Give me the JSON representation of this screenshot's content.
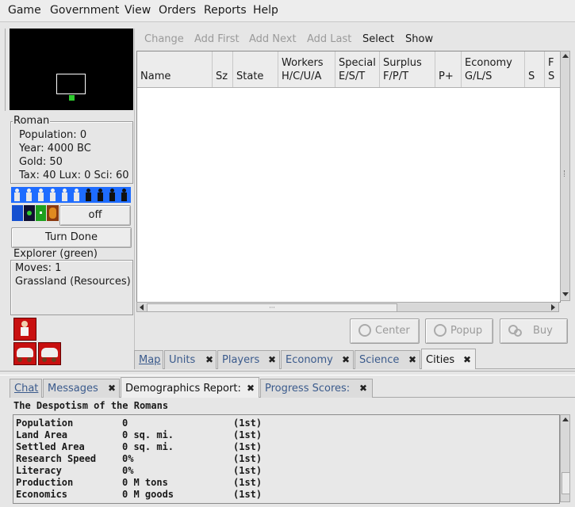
{
  "menu": [
    "Game",
    "Government",
    "View",
    "Orders",
    "Reports",
    "Help"
  ],
  "info": {
    "nation": "Roman",
    "population": "Population: 0",
    "year": "Year: 4000 BC",
    "gold": "Gold: 50",
    "rates": "Tax: 40 Lux: 0 Sci: 60"
  },
  "off_label": "off",
  "turn_done": "Turn Done",
  "unit_info": {
    "title": "Explorer (green)",
    "moves": "Moves: 1",
    "terrain": "Grassland (Resources)"
  },
  "cities_toolbar": [
    "Change",
    "Add First",
    "Add Next",
    "Add Last",
    "Select",
    "Show"
  ],
  "cities_columns": [
    {
      "l1": "",
      "l2": "Name"
    },
    {
      "l1": "",
      "l2": "Sz"
    },
    {
      "l1": "",
      "l2": "State"
    },
    {
      "l1": "Workers",
      "l2": "H/C/U/A"
    },
    {
      "l1": "Special",
      "l2": "E/S/T"
    },
    {
      "l1": "Surplus",
      "l2": "F/P/T"
    },
    {
      "l1": "",
      "l2": "P+"
    },
    {
      "l1": "Economy",
      "l2": "G/L/S"
    },
    {
      "l1": "",
      "l2": "S"
    },
    {
      "l1": "F",
      "l2": "S"
    }
  ],
  "hscroll_handle": "···",
  "action_buttons": {
    "center": "Center",
    "popup": "Popup",
    "buy": "Buy"
  },
  "upper_tabs": [
    {
      "label": "Map",
      "close": ""
    },
    {
      "label": "Units",
      "close": "✖"
    },
    {
      "label": "Players",
      "close": "✖"
    },
    {
      "label": "Economy",
      "close": "✖"
    },
    {
      "label": "Science",
      "close": "✖"
    },
    {
      "label": "Cities",
      "close": "✖"
    }
  ],
  "lower_tabs": [
    {
      "label": "Chat",
      "close": ""
    },
    {
      "label": "Messages",
      "close": "✖"
    },
    {
      "label": "Demographics Report:",
      "close": "✖"
    },
    {
      "label": "Progress Scores:",
      "close": "✖"
    }
  ],
  "demographics": {
    "title": "The Despotism of the Romans",
    "rows": [
      {
        "name": "Population",
        "value": "0",
        "rank": "(1st)"
      },
      {
        "name": "Land Area",
        "value": "0 sq. mi.",
        "rank": "(1st)"
      },
      {
        "name": "Settled Area",
        "value": "0 sq. mi.",
        "rank": "(1st)"
      },
      {
        "name": "Research Speed",
        "value": "0%",
        "rank": "(1st)"
      },
      {
        "name": "Literacy",
        "value": "0%",
        "rank": "(1st)"
      },
      {
        "name": "Production",
        "value": "0 M tons",
        "rank": "(1st)"
      },
      {
        "name": "Economics",
        "value": "0 M goods",
        "rank": "(1st)"
      }
    ]
  },
  "colors": {
    "accent": "#3a5a8c",
    "minimap_bg": "#000000",
    "unit_blue": "#1e6cff",
    "unit_red": "#c81010"
  }
}
